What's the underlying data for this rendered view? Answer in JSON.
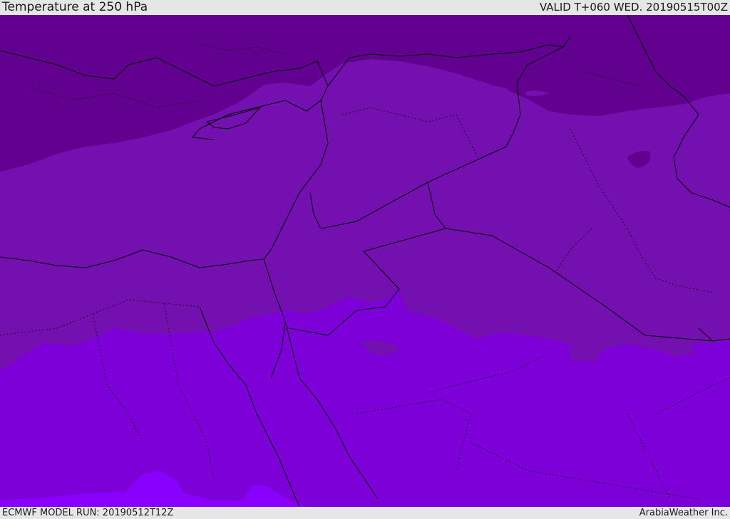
{
  "header": {
    "title": "Temperature at 250 hPa",
    "valid": "VALID T+060 WED. 20190515T00Z"
  },
  "footer": {
    "model_run": "ECMWF MODEL RUN: 20190512T12Z",
    "credit": "ArabiaWeather Inc."
  },
  "colors": {
    "band_coldest": "#62008f",
    "band_cold": "#7510b0",
    "band_mid": "#7d00d8",
    "band_warm": "#8a00ff",
    "border_line": "#000000"
  }
}
